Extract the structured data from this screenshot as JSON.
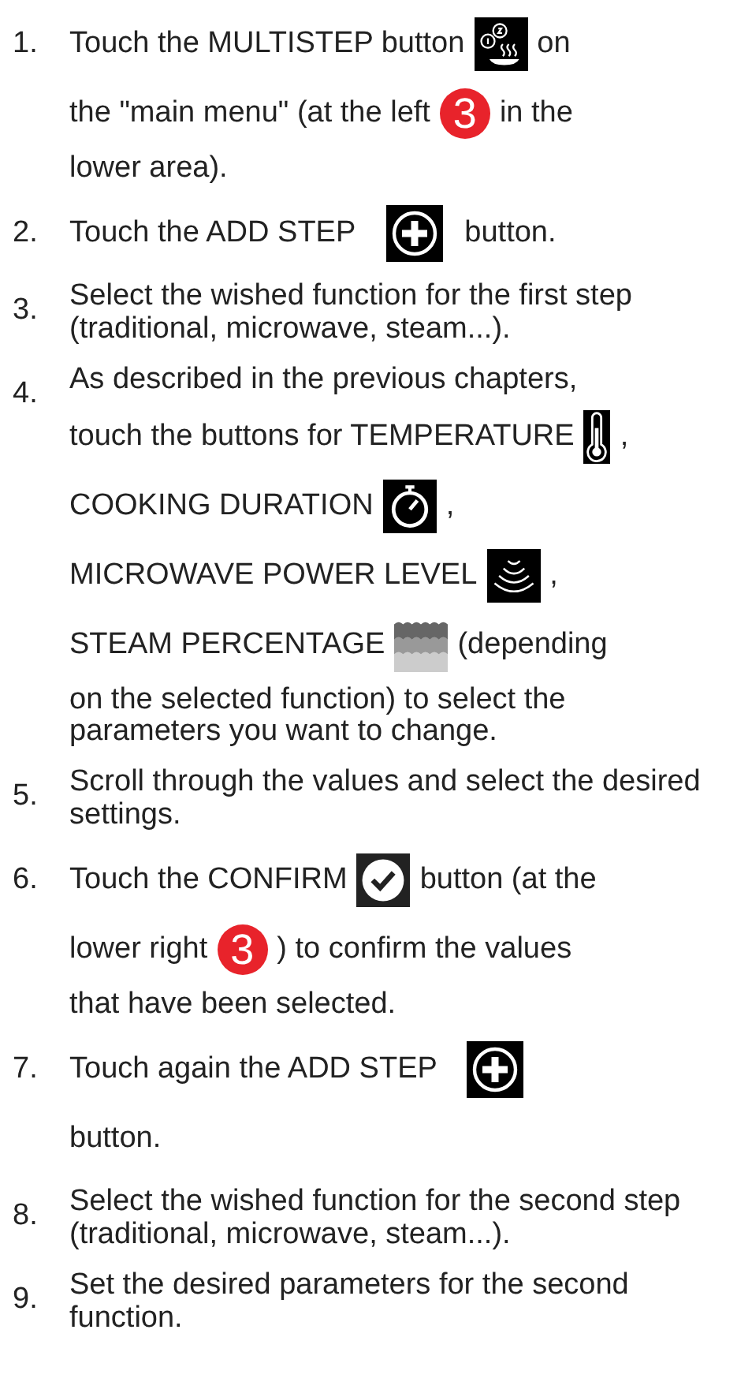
{
  "steps": [
    {
      "number": "1.",
      "parts": [
        {
          "kind": "text",
          "text": "Touch the MULTISTEP   button"
        },
        {
          "kind": "multistep"
        },
        {
          "kind": "text",
          "text": "on"
        },
        {
          "kind": "break"
        },
        {
          "kind": "text",
          "text": "the \"main menu\" (at the left"
        },
        {
          "kind": "badge",
          "text": "3"
        },
        {
          "kind": "text",
          "text": "in the"
        },
        {
          "kind": "break"
        },
        {
          "kind": "block",
          "text": "lower area)."
        }
      ]
    },
    {
      "number": "2.",
      "parts": [
        {
          "kind": "text",
          "text": "Touch the ADD STEP"
        },
        {
          "kind": "plus"
        },
        {
          "kind": "text",
          "text": "button."
        }
      ]
    },
    {
      "number": "3.",
      "parts": [
        {
          "kind": "block",
          "text": "Select the wished function for the first step (traditional, microwave, steam...)."
        }
      ]
    },
    {
      "number": "4.",
      "parts": [
        {
          "kind": "block",
          "text": "As described in the previous chapters,"
        },
        {
          "kind": "text",
          "text": "touch the buttons for TEMPERATURE"
        },
        {
          "kind": "thermometer"
        },
        {
          "kind": "text",
          "text": ","
        },
        {
          "kind": "break"
        },
        {
          "kind": "text",
          "text": "COOKING DURATION"
        },
        {
          "kind": "timer"
        },
        {
          "kind": "text",
          "text": ","
        },
        {
          "kind": "break"
        },
        {
          "kind": "text",
          "text": "MICROWAVE POWER LEVEL"
        },
        {
          "kind": "waves"
        },
        {
          "kind": "text",
          "text": ","
        },
        {
          "kind": "break"
        },
        {
          "kind": "text",
          "text": "STEAM PERCENTAGE"
        },
        {
          "kind": "steam"
        },
        {
          "kind": "text",
          "text": "(depending"
        },
        {
          "kind": "break"
        },
        {
          "kind": "block",
          "text": "on the selected function) to select the parameters you want to change."
        }
      ]
    },
    {
      "number": "5.",
      "parts": [
        {
          "kind": "block",
          "text": "Scroll through the values and select the desired settings."
        }
      ]
    },
    {
      "number": "6.",
      "parts": [
        {
          "kind": "text",
          "text": "Touch the CONFIRM"
        },
        {
          "kind": "check"
        },
        {
          "kind": "text",
          "text": "button (at the"
        },
        {
          "kind": "break"
        },
        {
          "kind": "text",
          "text": "lower right"
        },
        {
          "kind": "badge",
          "text": "3"
        },
        {
          "kind": "text",
          "text": ") to confirm the values"
        },
        {
          "kind": "break"
        },
        {
          "kind": "block",
          "text": "that have been selected."
        }
      ]
    },
    {
      "number": "7.",
      "parts": [
        {
          "kind": "text",
          "text": "Touch again the ADD STEP"
        },
        {
          "kind": "plus"
        },
        {
          "kind": "break"
        },
        {
          "kind": "text",
          "text": "button."
        }
      ]
    },
    {
      "number": "8.",
      "parts": [
        {
          "kind": "block",
          "text": "Select the wished function for the second step (traditional, microwave, steam...)."
        }
      ]
    },
    {
      "number": "9.",
      "parts": [
        {
          "kind": "block",
          "text": "Set the desired parameters for the second function."
        }
      ]
    }
  ]
}
